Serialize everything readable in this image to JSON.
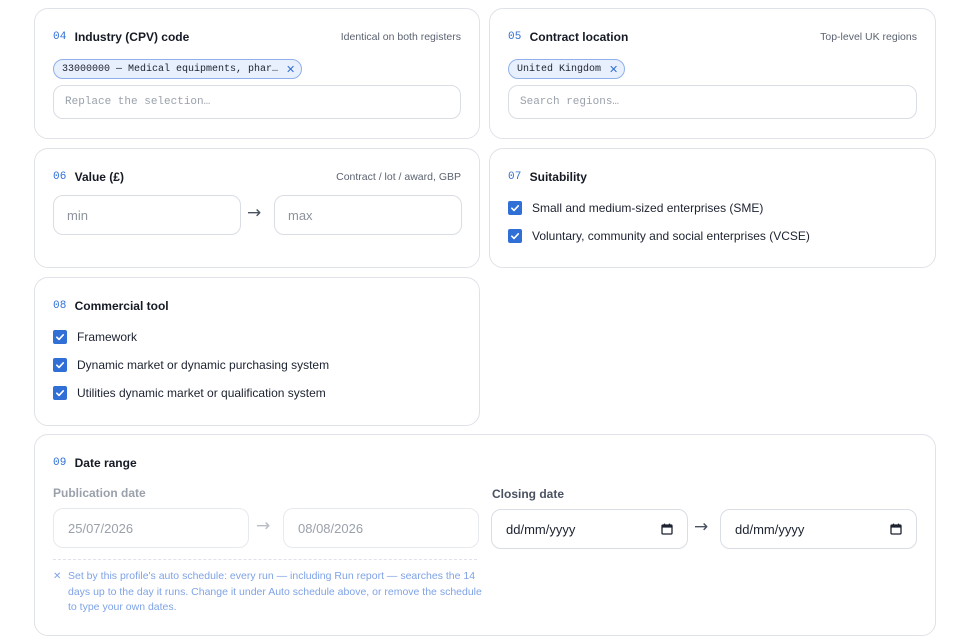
{
  "industry": {
    "number": "04",
    "title": "Industry (CPV) code",
    "hint": "Identical on both registers",
    "chip": "33000000 — Medical equipments, phar…",
    "placeholder": "Replace the selection…"
  },
  "location": {
    "number": "05",
    "title": "Contract location",
    "hint": "Top-level UK regions",
    "chip": "United Kingdom",
    "placeholder": "Search regions…"
  },
  "value": {
    "number": "06",
    "title": "Value (£)",
    "hint": "Contract / lot / award, GBP",
    "min_placeholder": "min",
    "max_placeholder": "max",
    "arrow": "→"
  },
  "suitability": {
    "number": "07",
    "title": "Suitability",
    "options": [
      {
        "label": "Small and medium-sized enterprises (SME)",
        "checked": true
      },
      {
        "label": "Voluntary, community and social enterprises (VCSE)",
        "checked": true
      }
    ]
  },
  "commercial_tool": {
    "number": "08",
    "title": "Commercial tool",
    "options": [
      {
        "label": "Framework",
        "checked": true
      },
      {
        "label": "Dynamic market or dynamic purchasing system",
        "checked": true
      },
      {
        "label": "Utilities dynamic market or qualification system",
        "checked": true
      }
    ]
  },
  "date_range": {
    "number": "09",
    "title": "Date range",
    "publication": {
      "label": "Publication date",
      "from": "25/07/2026",
      "to": "08/08/2026",
      "arrow": "→"
    },
    "closing": {
      "label": "Closing date",
      "from": "dd/mm/yyyy",
      "to": "dd/mm/yyyy",
      "arrow": "→"
    },
    "note": "Set by this profile's auto schedule: every run — including Run report — searches the 14 days up to the day it runs. Change it under Auto schedule above, or remove the schedule to type your own dates."
  },
  "icons": {
    "chip_remove": "close-icon",
    "checkbox": "checkmark-icon",
    "calendar": "calendar-icon",
    "note": "close-icon"
  },
  "colors": {
    "accent": "#2f6fd6",
    "chip_bg": "#e9f0fd",
    "chip_border": "#8fb0ea",
    "note_text": "#7fa3e6",
    "disabled_text": "#9aa1ab"
  }
}
